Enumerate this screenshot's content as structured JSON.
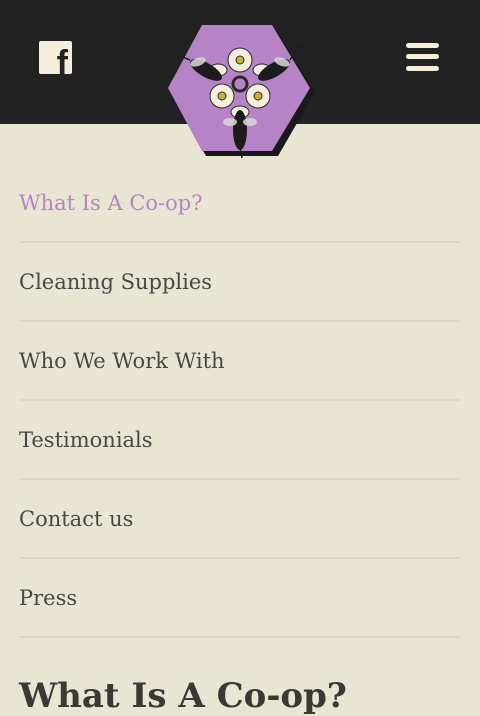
{
  "colors": {
    "header_bg": "#222222",
    "page_bg": "#e9e5d3",
    "accent": "#b683c4",
    "text": "#4a4744"
  },
  "header": {
    "facebook_icon": "facebook-icon",
    "menu_icon": "hamburger-menu-icon",
    "logo": "hexagon-bee-logo"
  },
  "nav": {
    "items": [
      {
        "label": "What Is A Co-op?",
        "active": true
      },
      {
        "label": "Cleaning Supplies",
        "active": false
      },
      {
        "label": "Who We Work With",
        "active": false
      },
      {
        "label": "Testimonials",
        "active": false
      },
      {
        "label": "Contact us",
        "active": false
      },
      {
        "label": "Press",
        "active": false
      }
    ]
  },
  "main": {
    "heading": "What Is A Co-op?"
  }
}
